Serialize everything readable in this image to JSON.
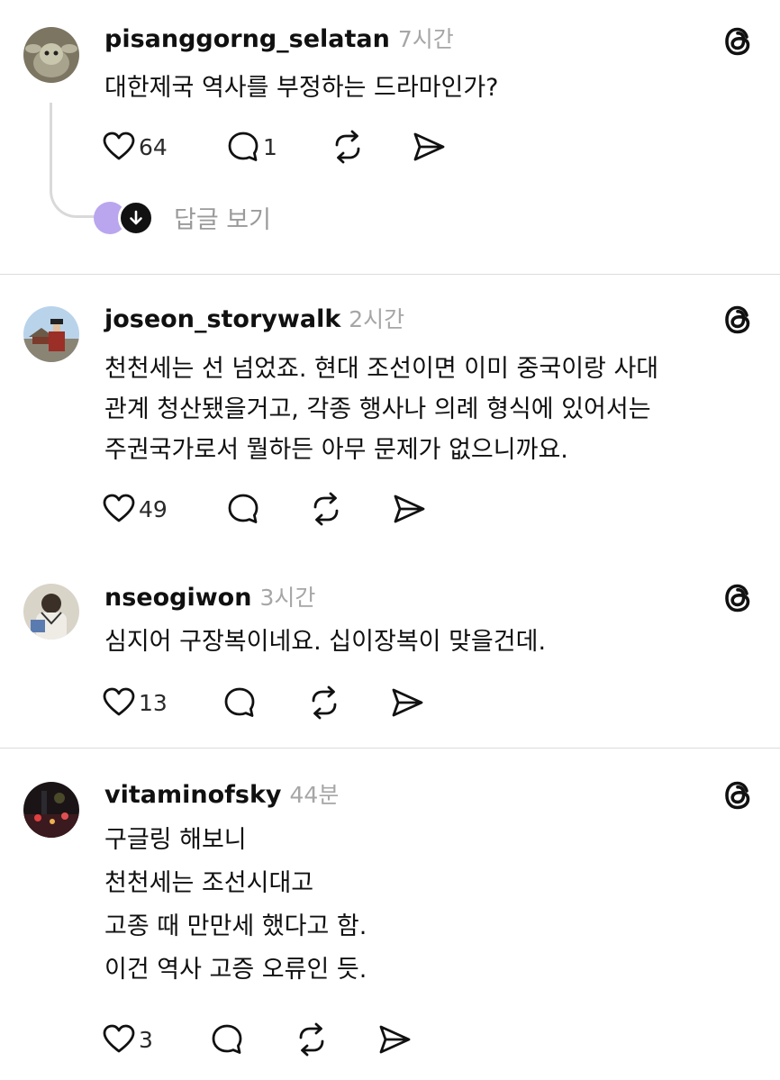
{
  "posts": [
    {
      "username": "pisanggorng_selatan",
      "time": "7시간",
      "lines": [
        "대한제국 역사를 부정하는 드라마인가?"
      ],
      "likes": "64",
      "comments": "1",
      "view_replies": "답글 보기"
    },
    {
      "username": "joseon_storywalk",
      "time": "2시간",
      "lines": [
        "천천세는 선 넘었죠. 현대 조선이면 이미 중국이랑 사대",
        "관계 청산됐을거고, 각종 행사나 의례 형식에 있어서는",
        "주권국가로서 뭘하든 아무 문제가 없으니까요."
      ],
      "likes": "49",
      "comments": ""
    },
    {
      "username": "nseogiwon",
      "time": "3시간",
      "lines": [
        "심지어 구장복이네요. 십이장복이 맞을건데."
      ],
      "likes": "13",
      "comments": ""
    },
    {
      "username": "vitaminofsky",
      "time": "44분",
      "lines": [
        "구글링 해보니",
        "천천세는 조선시대고",
        "고종 때 만만세 했다고 함.",
        "이건 역사 고증 오류인 듯."
      ],
      "likes": "3",
      "comments": ""
    }
  ],
  "icons": {
    "like": "heart-icon",
    "comment": "comment-bubble-icon",
    "repost": "repost-icon",
    "share": "send-icon",
    "brand": "threads-logo-icon"
  },
  "colors": {
    "text": "#101010",
    "muted": "#a6a6a6",
    "divider": "#dcdcdc",
    "reply_avatar": "#b9a6ee"
  }
}
